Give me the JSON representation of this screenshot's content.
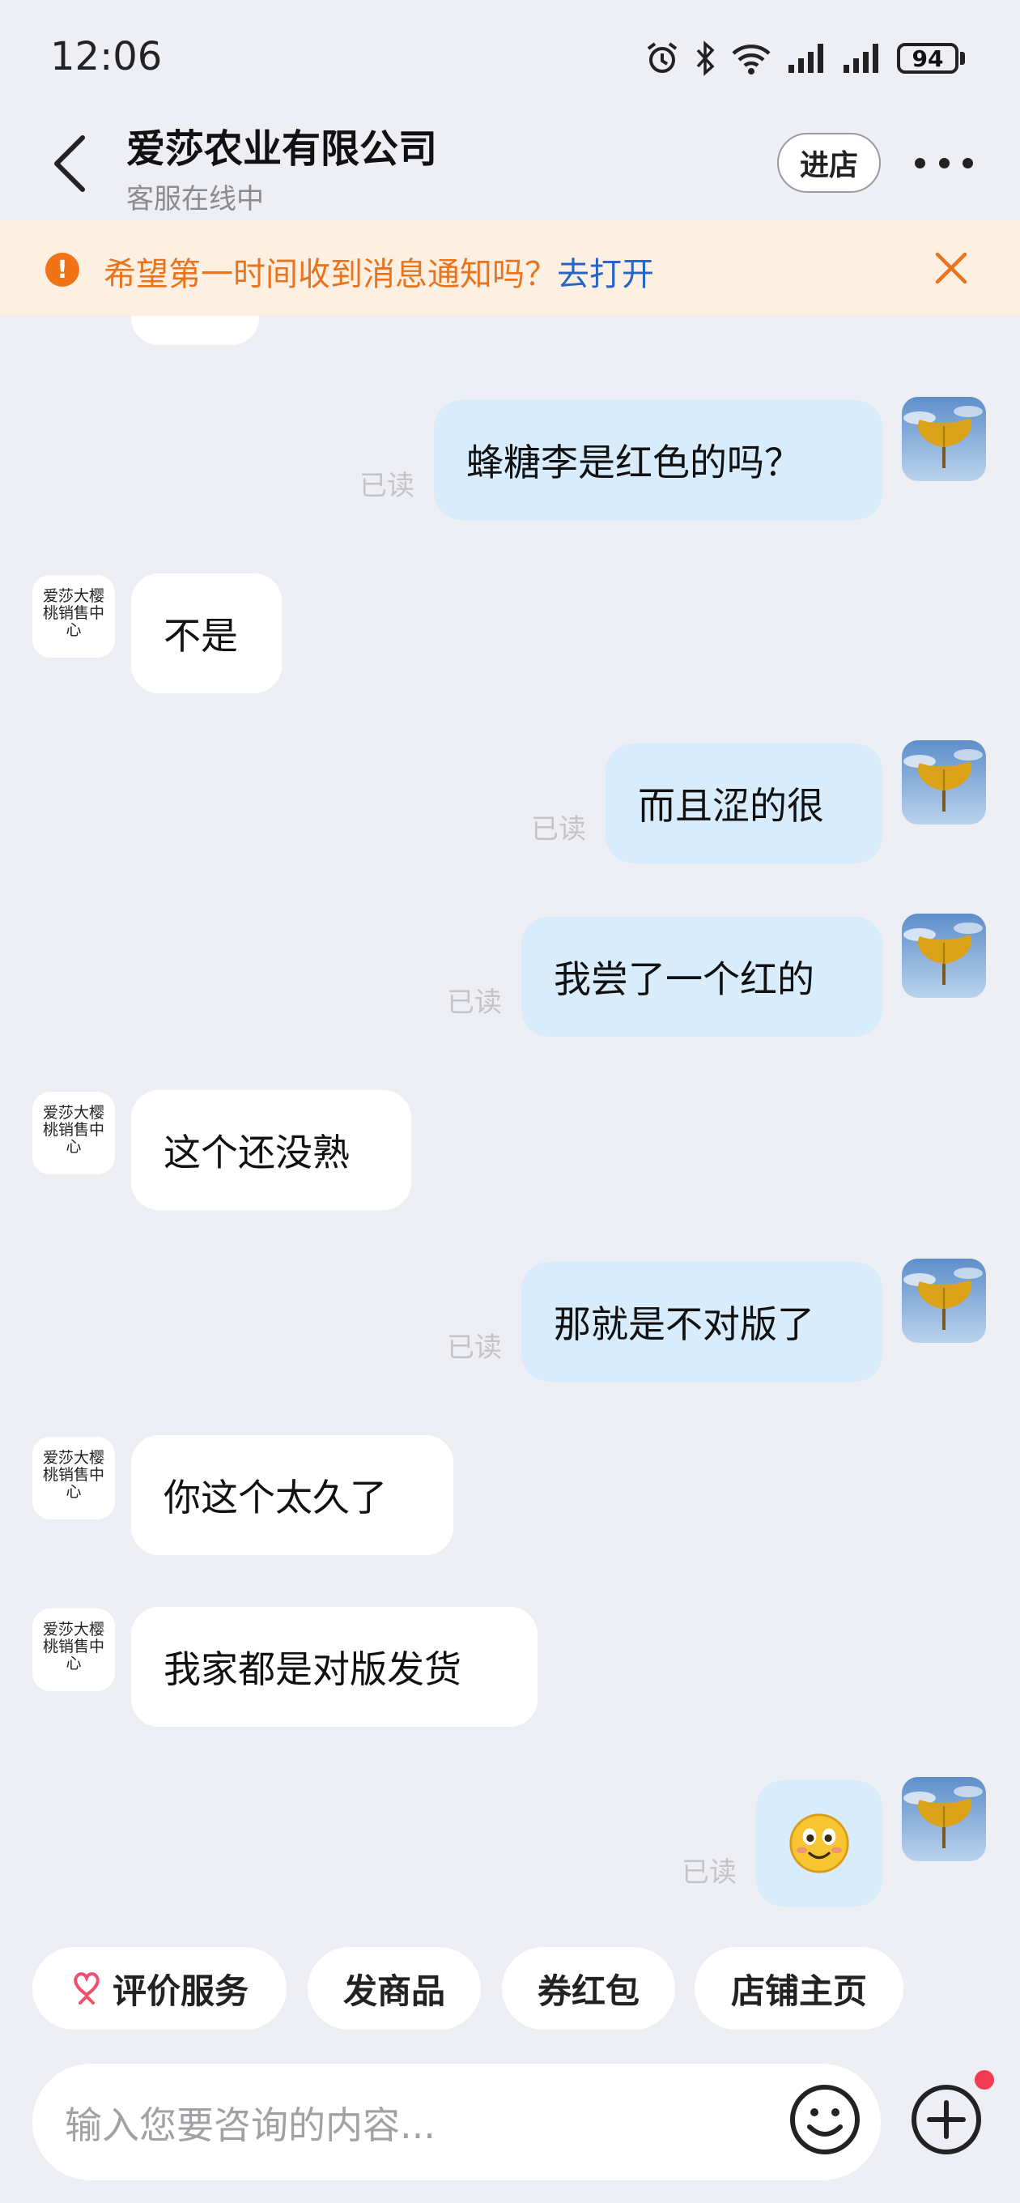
{
  "status_bar": {
    "time": "12:06",
    "battery": "94"
  },
  "header": {
    "title": "爱莎农业有限公司",
    "subtitle": "客服在线中",
    "store_button": "进店"
  },
  "banner": {
    "text": "希望第一时间收到消息通知吗？",
    "link": "去打开"
  },
  "shop_avatar_text": "爱莎大樱桃销售中心",
  "read_label": "已读",
  "messages": [
    {
      "from": "me",
      "text": "蜂糖李是红色的吗？",
      "status": "已读"
    },
    {
      "from": "shop",
      "text": "不是"
    },
    {
      "from": "me",
      "text": "而且涩的很",
      "status": "已读"
    },
    {
      "from": "me",
      "text": "我尝了一个红的",
      "status": "已读"
    },
    {
      "from": "shop",
      "text": "这个还没熟"
    },
    {
      "from": "me",
      "text": "那就是不对版了",
      "status": "已读"
    },
    {
      "from": "shop",
      "text": "你这个太久了"
    },
    {
      "from": "shop",
      "text": "我家都是对版发货"
    },
    {
      "from": "me",
      "text": "",
      "emoji": "smile-emoji",
      "status": "已读"
    }
  ],
  "quick_actions": [
    "评价服务",
    "发商品",
    "券红包",
    "店铺主页"
  ],
  "input": {
    "placeholder": "输入您要咨询的内容..."
  },
  "colors": {
    "accent_orange": "#E8751E",
    "link_blue": "#2566C2",
    "bubble_out": "#D8ECFB",
    "background": "#EEEEF5"
  }
}
